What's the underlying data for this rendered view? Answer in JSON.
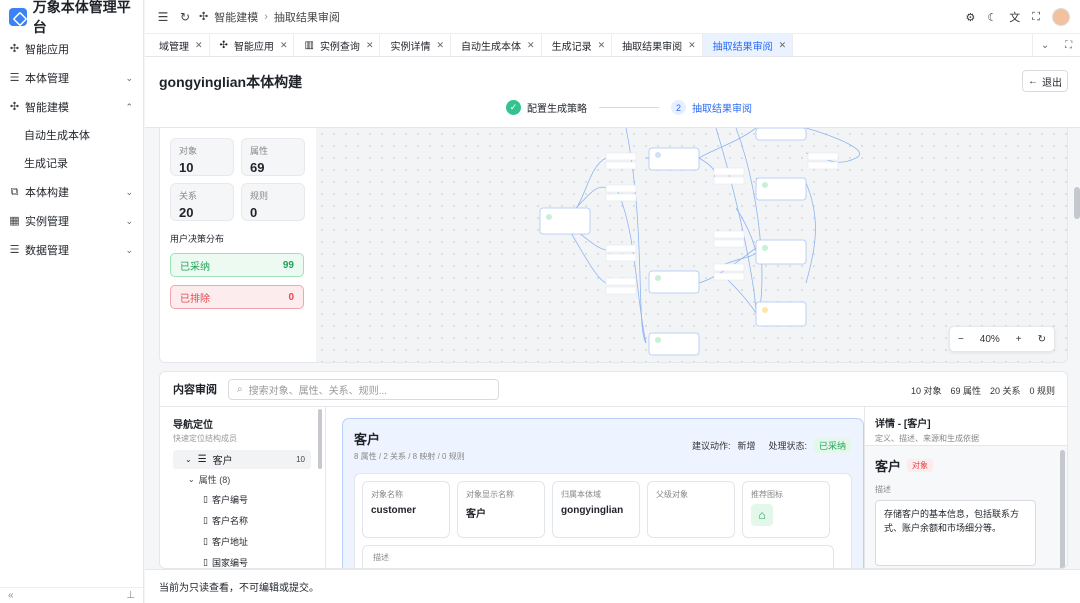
{
  "app": {
    "title": "万象本体管理平台"
  },
  "sidebar": {
    "items": [
      {
        "label": "智能应用",
        "icon": "sparkle-icon"
      },
      {
        "label": "本体管理",
        "icon": "database-icon"
      },
      {
        "label": "智能建模",
        "icon": "sparkle-icon"
      },
      {
        "label": "本体构建",
        "icon": "hierarchy-icon"
      },
      {
        "label": "实例管理",
        "icon": "grid-icon"
      },
      {
        "label": "数据管理",
        "icon": "database-icon"
      }
    ],
    "subitems": [
      "自动生成本体",
      "生成记录"
    ],
    "collapse": "«",
    "pin": "⊥"
  },
  "breadcrumb": {
    "parent": "智能建模",
    "current": "抽取结果审阅"
  },
  "tabs": [
    {
      "label": "域管理",
      "active": false
    },
    {
      "label": "智能应用",
      "active": false
    },
    {
      "label": "实例查询",
      "active": false
    },
    {
      "label": "实例详情",
      "active": false
    },
    {
      "label": "自动生成本体",
      "active": false
    },
    {
      "label": "生成记录",
      "active": false
    },
    {
      "label": "抽取结果审阅",
      "active": false
    },
    {
      "label": "抽取结果审阅",
      "active": true
    }
  ],
  "page": {
    "title": "gongyinglian本体构建",
    "back": "退出",
    "steps": [
      {
        "num": "✓",
        "label": "配置生成策略"
      },
      {
        "num": "2",
        "label": "抽取结果审阅"
      }
    ]
  },
  "stats": {
    "object": {
      "label": "对象",
      "value": "10"
    },
    "attribute": {
      "label": "属性",
      "value": "69"
    },
    "relation": {
      "label": "关系",
      "value": "20"
    },
    "rule": {
      "label": "规则",
      "value": "0"
    },
    "decision_title": "用户决策分布",
    "accepted": {
      "label": "已采纳",
      "value": "99"
    },
    "excluded": {
      "label": "已排除",
      "value": "0"
    }
  },
  "canvas": {
    "zoom": "40%",
    "minus": "−",
    "plus": "+",
    "reset": "↻"
  },
  "review": {
    "title": "内容审阅",
    "search_placeholder": "搜索对象、属性、关系、规则...",
    "counts": [
      "10 对象",
      "69 属性",
      "20 关系",
      "0 规则"
    ]
  },
  "tree": {
    "title": "导航定位",
    "subtitle": "快速定位结构成员",
    "node": {
      "label": "客户",
      "count": "10"
    },
    "attr_group": "属性 (8)",
    "leaves": [
      "客户编号",
      "客户名称",
      "客户地址",
      "国家编号"
    ]
  },
  "object_card": {
    "title": "客户",
    "subtitle": "8 属性 / 2 关系 / 8 映射 / 0 规则",
    "action_label": "建议动作:",
    "action_value": "新增",
    "status_label": "处理状态:",
    "status_value": "已采纳",
    "fields": [
      {
        "label": "对象名称",
        "value": "customer"
      },
      {
        "label": "对象显示名称",
        "value": "客户"
      },
      {
        "label": "归属本体域",
        "value": "gongyinglian"
      },
      {
        "label": "父级对象",
        "value": ""
      }
    ],
    "icon_label": "推荐图标",
    "desc_label": "描述"
  },
  "detail": {
    "title": "详情 - [客户]",
    "subtitle": "定义、描述、来源和生成依据",
    "name": "客户",
    "tag": "对象",
    "desc_label": "描述",
    "desc": "存储客户的基本信息，包括联系方式、账户余额和市场细分等。"
  },
  "footer": {
    "text": "当前为只读查看，不可编辑或提交。"
  },
  "colors": {
    "primary": "#2a6cf6",
    "success": "#22a35a",
    "danger": "#e5484d"
  }
}
